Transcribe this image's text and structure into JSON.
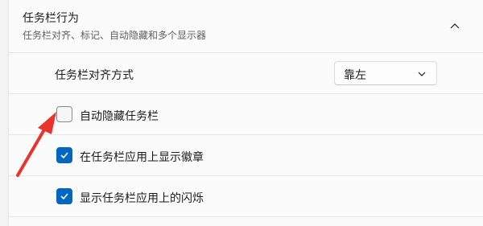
{
  "section": {
    "title": "任务栏行为",
    "subtitle": "任务栏对齐、标记、自动隐藏和多个显示器",
    "expanded": true
  },
  "alignment": {
    "label": "任务栏对齐方式",
    "selected": "靠左"
  },
  "options": [
    {
      "label": "自动隐藏任务栏",
      "checked": false
    },
    {
      "label": "在任务栏应用上显示徽章",
      "checked": true
    },
    {
      "label": "显示任务栏应用上的闪烁",
      "checked": true
    }
  ],
  "colors": {
    "accent": "#0067c0",
    "annotation_arrow": "#e8342c"
  },
  "icons": {
    "collapse": "chevron-up-icon",
    "dropdown": "chevron-down-icon",
    "check": "checkmark-icon",
    "annotation": "red-arrow-annotation"
  }
}
